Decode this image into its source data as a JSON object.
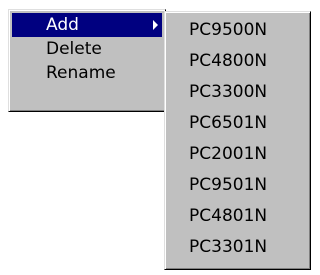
{
  "context_menu": {
    "items": [
      {
        "label": "Add",
        "selected": true,
        "has_submenu": true
      },
      {
        "label": "Delete",
        "selected": false,
        "has_submenu": false
      },
      {
        "label": "Rename",
        "selected": false,
        "has_submenu": false
      }
    ]
  },
  "submenu": {
    "items": [
      {
        "label": "PC9500N"
      },
      {
        "label": "PC4800N"
      },
      {
        "label": "PC3300N"
      },
      {
        "label": "PC6501N"
      },
      {
        "label": "PC2001N"
      },
      {
        "label": "PC9501N"
      },
      {
        "label": "PC4801N"
      },
      {
        "label": "PC3301N"
      }
    ]
  },
  "colors": {
    "menu_background": "#c0c0c0",
    "highlight_background": "#000080",
    "highlight_text": "#ffffff"
  },
  "icons": {
    "submenu_arrow": "submenu-arrow-icon"
  }
}
